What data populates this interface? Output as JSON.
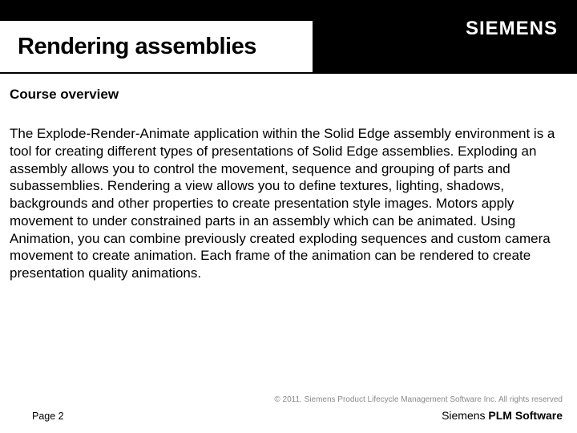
{
  "header": {
    "title": "Rendering assemblies",
    "logo_text": "SIEMENS"
  },
  "subtitle": "Course overview",
  "body": "The Explode-Render-Animate application within the Solid Edge assembly environment is a tool for creating different types of presentations of Solid Edge assemblies. Exploding an assembly allows you to control the movement, sequence and grouping of parts and subassemblies. Rendering a view allows you to define textures, lighting, shadows, backgrounds and other properties to create presentation style images. Motors apply movement to under constrained parts in an assembly which can be animated. Using Animation, you can combine previously created exploding sequences and custom camera movement to create animation. Each frame of the animation can be rendered to create presentation quality animations.",
  "footer": {
    "copyright": "© 2011. Siemens Product Lifecycle Management Software Inc. All rights reserved",
    "page": "Page 2",
    "brand_prefix": "Siemens ",
    "brand_bold": "PLM Software"
  }
}
